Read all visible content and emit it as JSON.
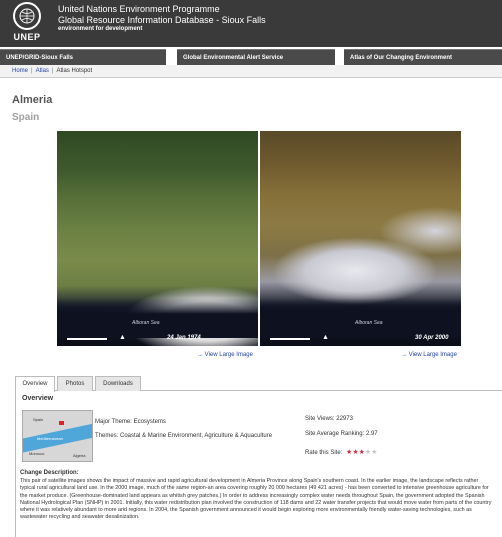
{
  "header": {
    "logo_text": "UNEP",
    "org_line1": "United Nations Environment Programme",
    "org_line2": "Global Resource Information Database - Sioux Falls",
    "tagline": "environment for development"
  },
  "nav": {
    "tabs": [
      {
        "label": "UNEP/GRID-Sioux Falls"
      },
      {
        "label": "Global Environmental Alert Service"
      },
      {
        "label": "Atlas of Our Changing Environment"
      }
    ]
  },
  "breadcrumb": [
    "Home",
    "Atlas",
    "Atlas Hotspot"
  ],
  "page": {
    "title": "Almeria",
    "subtitle": "Spain"
  },
  "images": {
    "left": {
      "date": "24 Jan 1974",
      "sea_label": "Alboran Sea",
      "link": "View Large Image"
    },
    "right": {
      "date": "30 Apr 2000",
      "sea_label": "Alboran Sea",
      "link": "View Large Image"
    }
  },
  "tabs": [
    {
      "label": "Overview"
    },
    {
      "label": "Photos"
    },
    {
      "label": "Downloads"
    }
  ],
  "overview": {
    "heading": "Overview",
    "map_labels": {
      "spain": "Spain",
      "sea": "Mediterranean",
      "morocco": "Morocco",
      "algeria": "Algeria"
    },
    "major_theme_label": "Major Theme:",
    "major_theme": "Ecosystems",
    "themes_label": "Themes:",
    "themes": "Coastal & Marine Environment, Agriculture & Aquaculture",
    "site_views_label": "Site Views:",
    "site_views": "22973",
    "ranking_label": "Site Average Ranking:",
    "ranking": "2.97",
    "rate_label": "Rate this Site:",
    "rating_stars": 3,
    "rating_max": 5,
    "desc_heading": "Change Description:",
    "description": "This pair of satellite images shows the impact of massive and rapid agricultural development in Almeria Province along Spain's southern coast. In the earlier image, the landscape reflects rather typical rural agricultural land use. In the 2000 image, much of the same region-an area covering roughly 20 000 hectares (49 421 acres) - has been converted to intensive greenhouse agriculture for the market produce. (Greenhouse-dominated land appears as whitish grey patches.) In order to address increasingly complex water needs throughout Spain, the government adopted the Spanish National Hydrological Plan (SNHP) in 2001. Initially, this water redistribution plan involved the construction of 118 dams and 22 water transfer projects that would move water from parts of the country where it was relatively abundant to more arid regions. In 2004, the Spanish government announced it would begin exploring more environmentally friendly water-saving technologies, such as wastewater recycling and seawater desalinization."
  }
}
